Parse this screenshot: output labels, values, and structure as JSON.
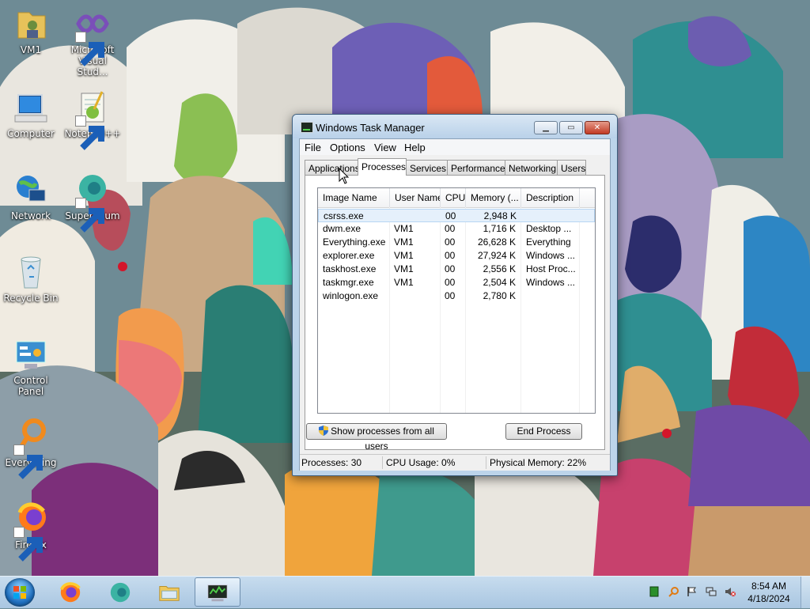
{
  "desktop": {
    "icons": [
      {
        "label": "VM1"
      },
      {
        "label": "Microsoft Visual Stud..."
      },
      {
        "label": "Computer"
      },
      {
        "label": "Notepad++"
      },
      {
        "label": "Network"
      },
      {
        "label": "Supermium"
      },
      {
        "label": "Recycle Bin"
      },
      {
        "label": "Control Panel"
      },
      {
        "label": "Everything"
      },
      {
        "label": "Firefox"
      }
    ]
  },
  "window": {
    "title": "Windows Task Manager",
    "controls": {
      "minimize": "▁",
      "maximize": "▭",
      "close": "✕"
    },
    "menu": [
      "File",
      "Options",
      "View",
      "Help"
    ],
    "tabs": [
      "Applications",
      "Processes",
      "Services",
      "Performance",
      "Networking",
      "Users"
    ],
    "active_tab": "Processes",
    "columns": [
      "Image Name",
      "User Name",
      "CPU",
      "Memory (...",
      "Description"
    ],
    "processes": [
      {
        "image": "csrss.exe",
        "user": "",
        "cpu": "00",
        "memory": "2,948 K",
        "description": ""
      },
      {
        "image": "dwm.exe",
        "user": "VM1",
        "cpu": "00",
        "memory": "1,716 K",
        "description": "Desktop ..."
      },
      {
        "image": "Everything.exe",
        "user": "VM1",
        "cpu": "00",
        "memory": "26,628 K",
        "description": "Everything"
      },
      {
        "image": "explorer.exe",
        "user": "VM1",
        "cpu": "00",
        "memory": "27,924 K",
        "description": "Windows ..."
      },
      {
        "image": "taskhost.exe",
        "user": "VM1",
        "cpu": "00",
        "memory": "2,556 K",
        "description": "Host Proc..."
      },
      {
        "image": "taskmgr.exe",
        "user": "VM1",
        "cpu": "00",
        "memory": "2,504 K",
        "description": "Windows ..."
      },
      {
        "image": "winlogon.exe",
        "user": "",
        "cpu": "00",
        "memory": "2,780 K",
        "description": ""
      }
    ],
    "selected_row": 0,
    "buttons": {
      "show_all": "Show processes from all users",
      "end_process": "End Process"
    },
    "status": {
      "processes": "Processes: 30",
      "cpu": "CPU Usage: 0%",
      "memory": "Physical Memory: 22%"
    }
  },
  "taskbar": {
    "items": [
      "Firefox",
      "Supermium",
      "Windows Explorer",
      "Windows Task Manager"
    ],
    "active_item": "Windows Task Manager",
    "time": "8:54 AM",
    "date": "4/18/2024"
  },
  "colors": {
    "selection": "#e5f0fb",
    "title_bar": "#bcd4ea",
    "close_button": "#c23a24",
    "taskbar": "#b3cde4"
  }
}
